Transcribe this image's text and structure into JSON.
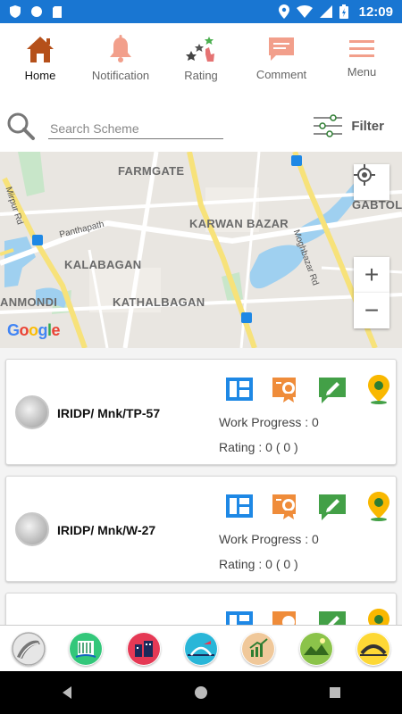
{
  "status_bar": {
    "time": "12:09"
  },
  "nav": {
    "items": [
      {
        "label": "Home"
      },
      {
        "label": "Notification"
      },
      {
        "label": "Rating"
      },
      {
        "label": "Comment"
      },
      {
        "label": "Menu"
      }
    ]
  },
  "search": {
    "placeholder": "Search Scheme",
    "filter_label": "Filter"
  },
  "map": {
    "labels": [
      "FARMGATE",
      "KARWAN BAZAR",
      "KALABAGAN",
      "KATHALBAGAN",
      "ANMONDI",
      "GABTOL"
    ],
    "roads": [
      "Mirpur Rd",
      "Panthapath",
      "Moghbazar Rd"
    ],
    "zoom_in": "+",
    "zoom_out": "−",
    "logo": "Google"
  },
  "schemes": [
    {
      "title": "IRIDP/ Mnk/TP-57",
      "progress_label": "Work Progress :",
      "progress_value": "0",
      "rating_label": "Rating :",
      "rating_value": "0 ( 0 )"
    },
    {
      "title": "IRIDP/ Mnk/W-27",
      "progress_label": "Work Progress :",
      "progress_value": "0",
      "rating_label": "Rating :",
      "rating_value": "0 ( 0 )"
    },
    {
      "title": "",
      "progress_label": "",
      "progress_value": "",
      "rating_label": "",
      "rating_value": ""
    }
  ],
  "colors": {
    "status_bar": "#1976d2",
    "icon_orange": "#ef6c3a",
    "icon_blue": "#1e88e5",
    "icon_green": "#43a047",
    "icon_yellow": "#f9b800"
  }
}
